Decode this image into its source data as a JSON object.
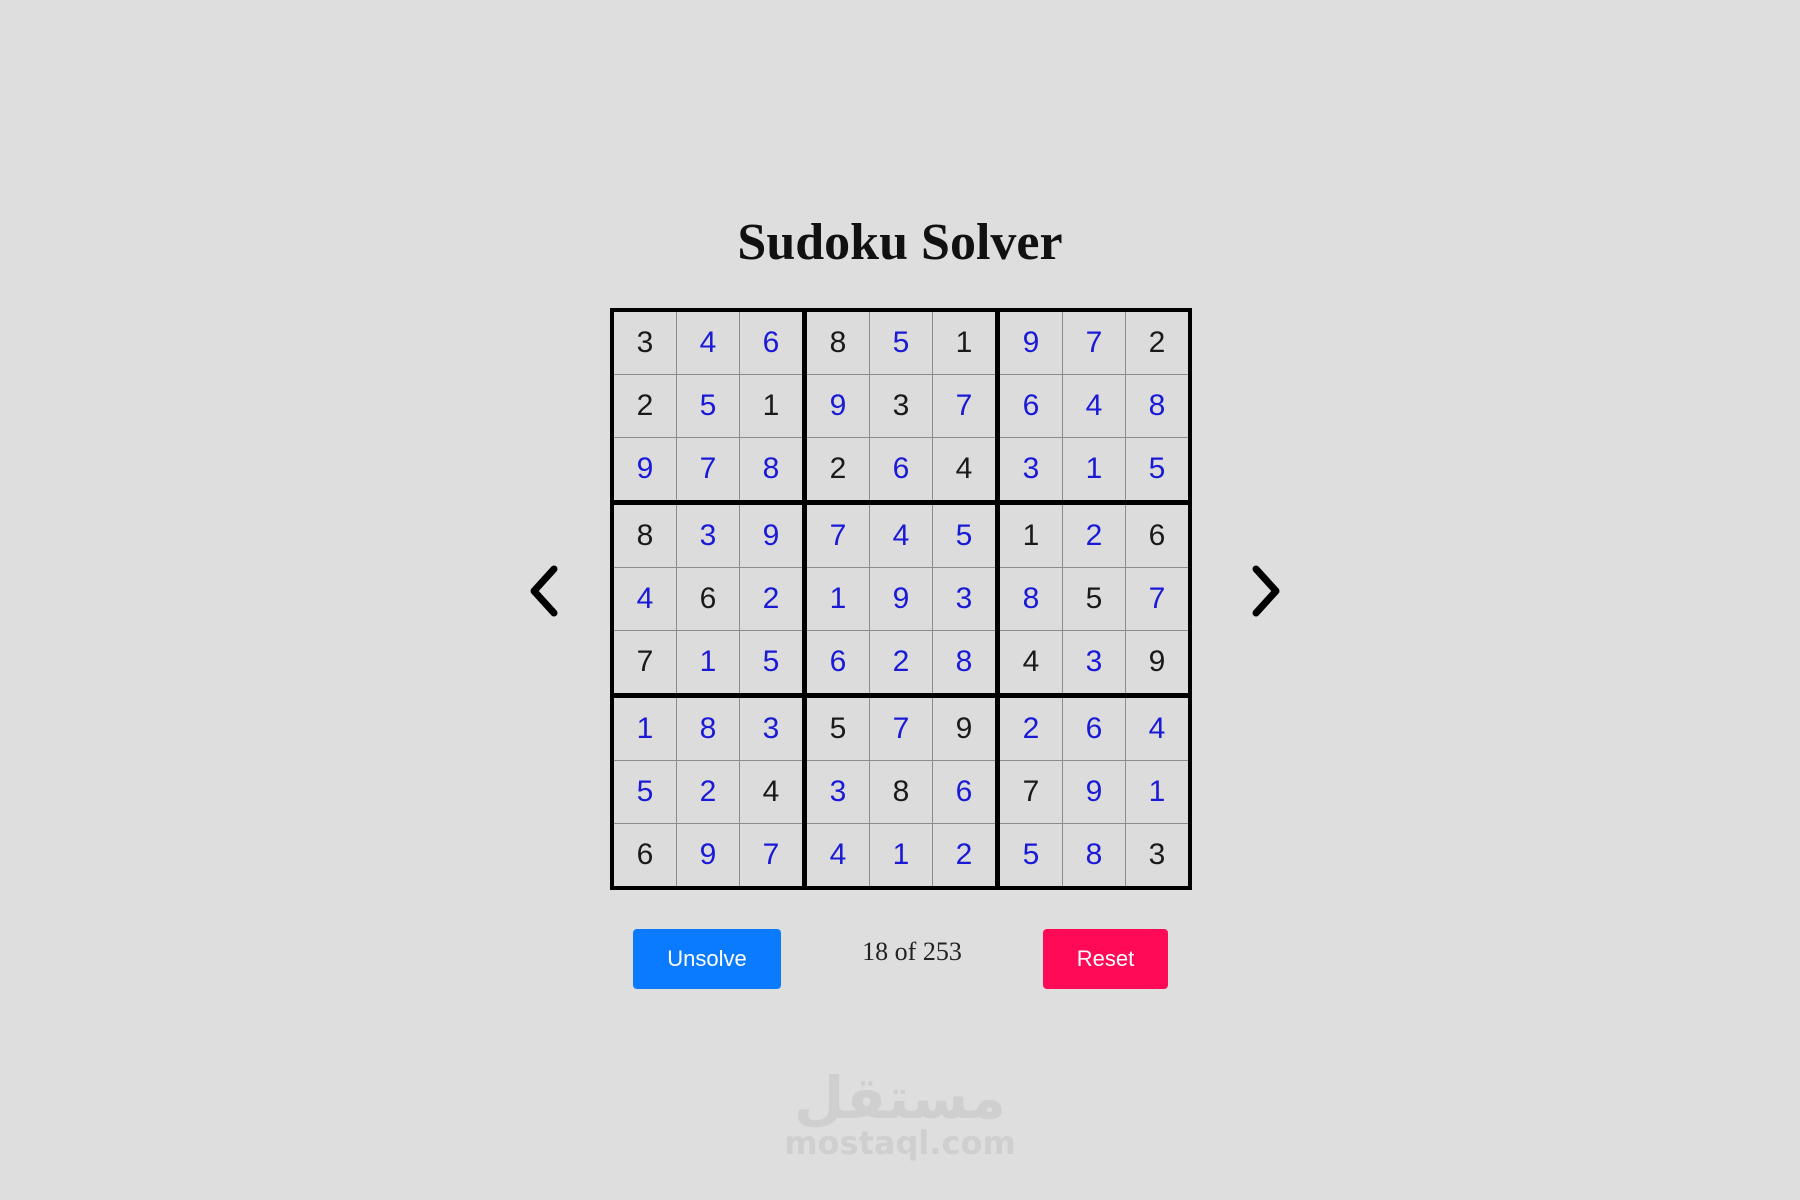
{
  "title": "Sudoku Solver",
  "board": {
    "rows": [
      [
        "3",
        "4",
        "6",
        "8",
        "5",
        "1",
        "9",
        "7",
        "2"
      ],
      [
        "2",
        "5",
        "1",
        "9",
        "3",
        "7",
        "6",
        "4",
        "8"
      ],
      [
        "9",
        "7",
        "8",
        "2",
        "6",
        "4",
        "3",
        "1",
        "5"
      ],
      [
        "8",
        "3",
        "9",
        "7",
        "4",
        "5",
        "1",
        "2",
        "6"
      ],
      [
        "4",
        "6",
        "2",
        "1",
        "9",
        "3",
        "8",
        "5",
        "7"
      ],
      [
        "7",
        "1",
        "5",
        "6",
        "2",
        "8",
        "4",
        "3",
        "9"
      ],
      [
        "1",
        "8",
        "3",
        "5",
        "7",
        "9",
        "2",
        "6",
        "4"
      ],
      [
        "5",
        "2",
        "4",
        "3",
        "8",
        "6",
        "7",
        "9",
        "1"
      ],
      [
        "6",
        "9",
        "7",
        "4",
        "1",
        "2",
        "5",
        "8",
        "3"
      ]
    ],
    "given": [
      [
        1,
        0,
        0,
        1,
        0,
        1,
        0,
        0,
        1
      ],
      [
        1,
        0,
        1,
        0,
        1,
        0,
        0,
        0,
        0
      ],
      [
        0,
        0,
        0,
        1,
        0,
        1,
        0,
        0,
        0
      ],
      [
        1,
        0,
        0,
        0,
        0,
        0,
        1,
        0,
        1
      ],
      [
        0,
        1,
        0,
        0,
        0,
        0,
        0,
        1,
        0
      ],
      [
        1,
        0,
        0,
        0,
        0,
        0,
        1,
        0,
        1
      ],
      [
        0,
        0,
        0,
        1,
        0,
        1,
        0,
        0,
        0
      ],
      [
        0,
        0,
        1,
        0,
        1,
        0,
        1,
        0,
        0
      ],
      [
        1,
        0,
        0,
        0,
        0,
        0,
        0,
        0,
        1
      ]
    ],
    "colors": {
      "given": "#1a1a1a",
      "solved": "#1a1ad6"
    }
  },
  "nav": {
    "prev_icon": "chevron-left-icon",
    "next_icon": "chevron-right-icon"
  },
  "controls": {
    "unsolve_label": "Unsolve",
    "counter": "18 of 253",
    "reset_label": "Reset",
    "colors": {
      "unsolve": "#0a7bff",
      "reset": "#ff0a57"
    }
  },
  "watermark": {
    "arabic": "مستقل",
    "latin": "mostaql.com"
  }
}
